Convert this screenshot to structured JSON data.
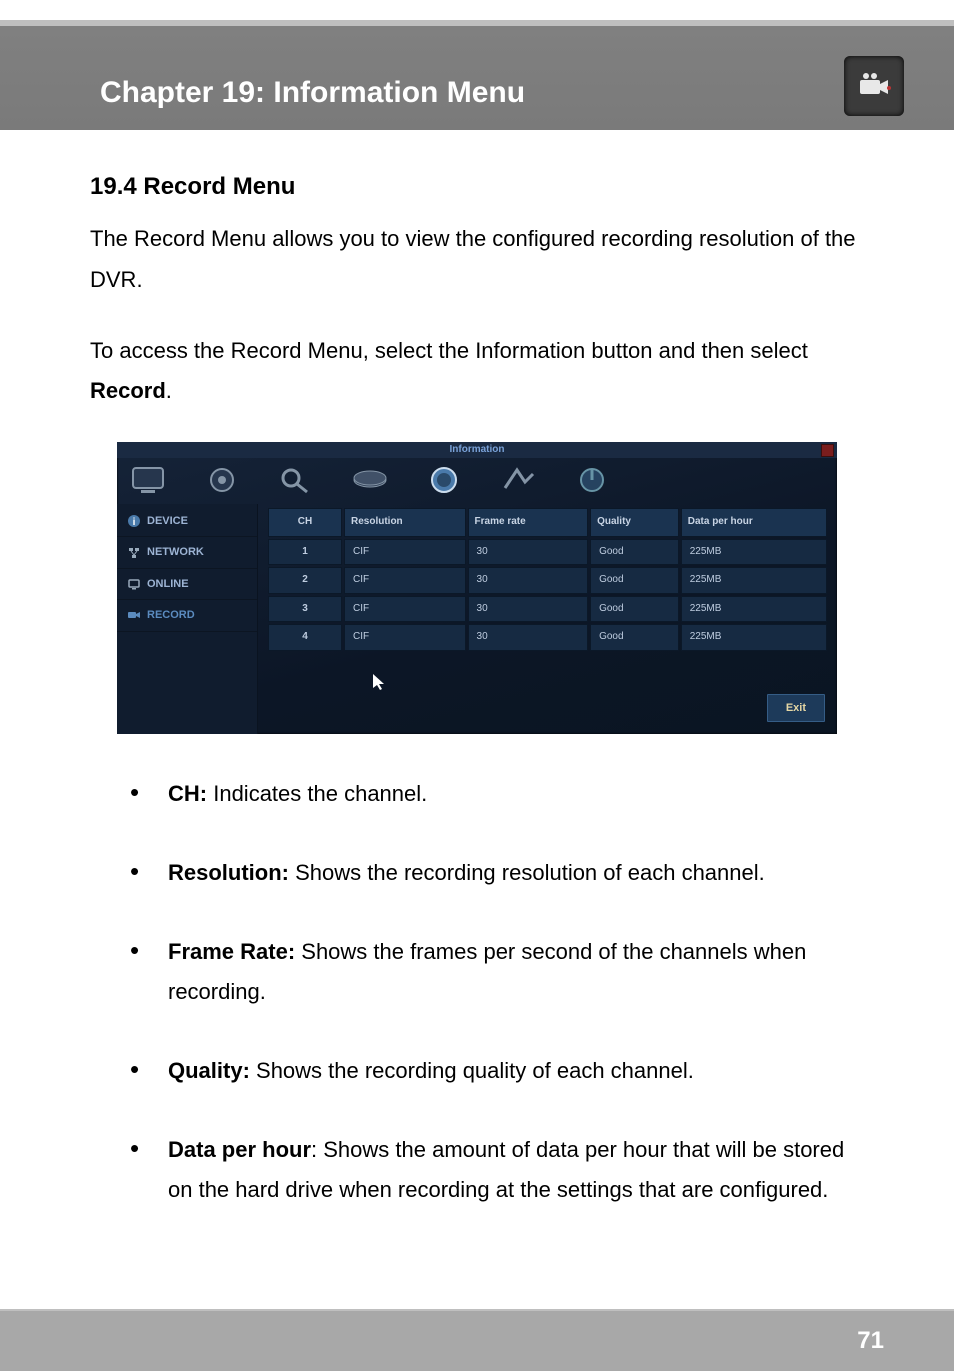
{
  "header": {
    "title": "Chapter 19: Information Menu"
  },
  "section": {
    "heading": "19.4 Record Menu",
    "intro": "The Record Menu allows you to view the configured recording resolution of the DVR.",
    "access_pre": "To access the Record Menu, select the Information button and then select ",
    "access_bold": "Record",
    "access_post": "."
  },
  "dvr": {
    "title": "Information",
    "sidebar": [
      {
        "label": "DEVICE",
        "selected": false
      },
      {
        "label": "NETWORK",
        "selected": false
      },
      {
        "label": "ONLINE",
        "selected": false
      },
      {
        "label": "RECORD",
        "selected": true
      }
    ],
    "columns": [
      "CH",
      "Resolution",
      "Frame rate",
      "Quality",
      "Data per hour"
    ],
    "rows": [
      {
        "ch": "1",
        "resolution": "CIF",
        "frame_rate": "30",
        "quality": "Good",
        "data_per_hour": "225MB"
      },
      {
        "ch": "2",
        "resolution": "CIF",
        "frame_rate": "30",
        "quality": "Good",
        "data_per_hour": "225MB"
      },
      {
        "ch": "3",
        "resolution": "CIF",
        "frame_rate": "30",
        "quality": "Good",
        "data_per_hour": "225MB"
      },
      {
        "ch": "4",
        "resolution": "CIF",
        "frame_rate": "30",
        "quality": "Good",
        "data_per_hour": "225MB"
      }
    ],
    "exit_label": "Exit"
  },
  "definitions": [
    {
      "term": "CH:",
      "desc": " Indicates the channel."
    },
    {
      "term": "Resolution:",
      "desc": " Shows the recording resolution of each channel."
    },
    {
      "term": "Frame Rate:",
      "desc": " Shows the frames per second of the channels when recording."
    },
    {
      "term": "Quality:",
      "desc": " Shows the recording quality of each channel."
    },
    {
      "term": "Data per hour",
      "desc": ": Shows the amount of data per hour that will be stored on the hard drive when recording at the settings that are configured."
    }
  ],
  "footer": {
    "page_number": "71"
  }
}
